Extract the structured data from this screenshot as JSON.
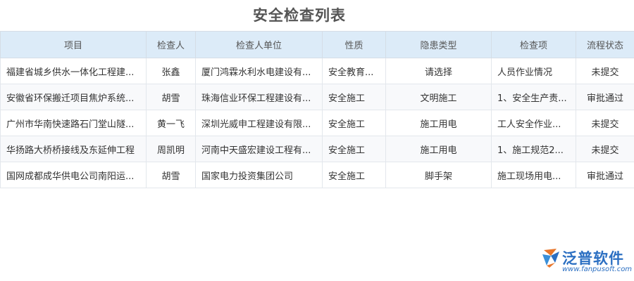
{
  "page": {
    "title": "安全检查列表"
  },
  "table": {
    "columns": [
      "项目",
      "检查人",
      "检查人单位",
      "性质",
      "隐患类型",
      "检查项",
      "流程状态"
    ],
    "rows": [
      {
        "project": "福建省城乡供水一体化工程建...",
        "inspector": "张鑫",
        "unit": "厦门鸿霖水利水电建设有...",
        "nature": "安全教育...",
        "hazard": "请选择",
        "item": "人员作业情况",
        "status": "未提交",
        "status_kind": "pending"
      },
      {
        "project": "安徽省环保搬迁项目焦炉系统...",
        "inspector": "胡雪",
        "unit": "珠海信业环保工程建设有...",
        "nature": "安全施工",
        "hazard": "文明施工",
        "item": "1、安全生产责...",
        "status": "审批通过",
        "status_kind": "approved"
      },
      {
        "project": "广州市华南快速路石门堂山隧...",
        "inspector": "黄一飞",
        "unit": "深圳光威申工程建设有限...",
        "nature": "安全施工",
        "hazard": "施工用电",
        "item": "工人安全作业...",
        "status": "未提交",
        "status_kind": "pending"
      },
      {
        "project": "华扬路大桥桥接线及东延伸工程",
        "inspector": "周凯明",
        "unit": "河南中天盛宏建设工程有...",
        "nature": "安全施工",
        "hazard": "施工用电",
        "item": "1、施工规范2...",
        "status": "未提交",
        "status_kind": "pending"
      },
      {
        "project": "国网成都成华供电公司南阳运...",
        "inspector": "胡雪",
        "unit": "国家电力投资集团公司",
        "nature": "安全施工",
        "hazard": "脚手架",
        "item": "施工现场用电...",
        "status": "审批通过",
        "status_kind": "approved"
      }
    ]
  },
  "colors": {
    "header_bg": "#dcebf8",
    "link": "#2a77c9",
    "pending": "#1a2fcf",
    "approved": "#2e8b2e",
    "brand": "#2b6fc2"
  },
  "branding": {
    "name": "泛普软件",
    "url": "www.fanpusoft.com",
    "icon": "fanpu-logo-icon"
  }
}
